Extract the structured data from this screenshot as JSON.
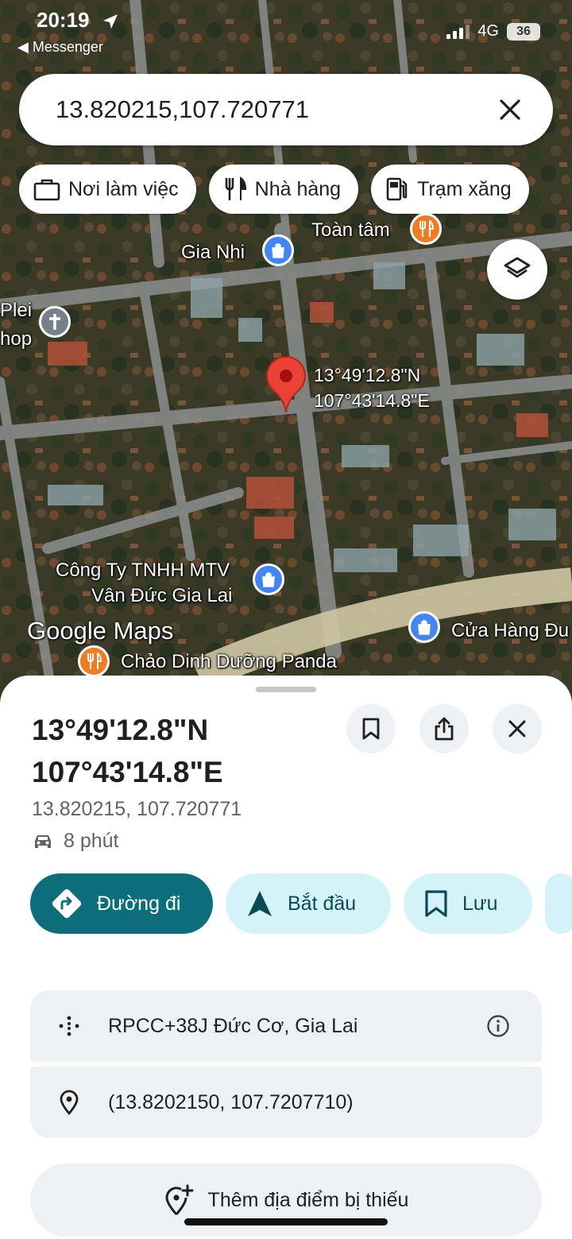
{
  "status_bar": {
    "time": "20:19",
    "back_app": "Messenger",
    "network": "4G",
    "battery": "36"
  },
  "search": {
    "query": "13.820215,107.720771"
  },
  "chips": [
    {
      "label": "Nơi làm việc",
      "icon": "briefcase-icon"
    },
    {
      "label": "Nhà hàng",
      "icon": "fork-knife-icon"
    },
    {
      "label": "Trạm xăng",
      "icon": "gas-station-icon"
    }
  ],
  "map": {
    "labels": {
      "toan_tam": "Toàn tâm",
      "gia_nhi": "Gia Nhi",
      "plei_1": "Plei",
      "plei_2": "hop",
      "cong_ty_1": "Công Ty TNHH MTV",
      "cong_ty_2": "Vân Đức Gia Lai",
      "cua_hang": "Cửa Hàng Đu",
      "chao": "Chảo Dinh Dưỡng Panda"
    },
    "pin_lat": "13°49'12.8\"N",
    "pin_lng": "107°43'14.8\"E",
    "watermark": "Google Maps"
  },
  "sheet": {
    "title_line1": "13°49'12.8\"N",
    "title_line2": "107°43'14.8\"E",
    "coords": "13.820215, 107.720771",
    "drive_time": "8 phút",
    "actions": {
      "directions": "Đường đi",
      "start": "Bắt đầu",
      "save": "Lưu"
    },
    "plus_code": "RPCC+38J Đức Cơ, Gia Lai",
    "decimal_coords": "(13.8202150, 107.7207710)",
    "add_place": "Thêm địa điểm bị thiếu"
  },
  "colors": {
    "primary_teal": "#0b6e7a",
    "secondary_chip": "#d4f3f8",
    "pin_red": "#ea4335",
    "poi_blue": "#4285f4",
    "poi_orange": "#f07c22"
  }
}
